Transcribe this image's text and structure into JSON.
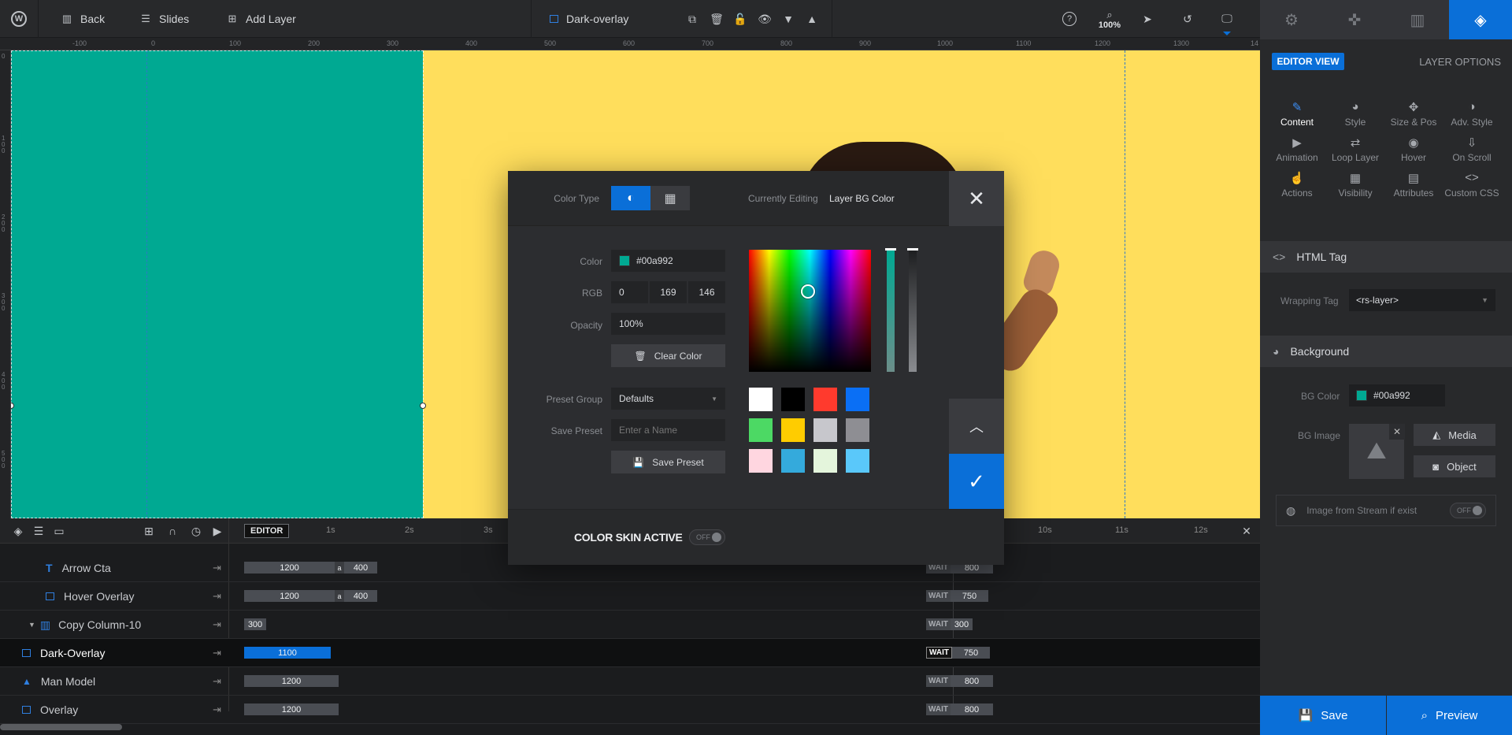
{
  "topbar": {
    "back": "Back",
    "slides": "Slides",
    "add_layer": "Add Layer",
    "layer_name": "Dark-overlay",
    "zoom": "100%"
  },
  "rpanel": {
    "tabs": [
      "settings",
      "navigation",
      "slides",
      "layers"
    ],
    "editor_view": "EDITOR VIEW",
    "layer_options": "LAYER OPTIONS",
    "options": [
      {
        "label": "Content",
        "icon": "✎"
      },
      {
        "label": "Style",
        "icon": "◕"
      },
      {
        "label": "Size & Pos",
        "icon": "✥"
      },
      {
        "label": "Adv. Style",
        "icon": "◑"
      },
      {
        "label": "Animation",
        "icon": "▶"
      },
      {
        "label": "Loop Layer",
        "icon": "⇄"
      },
      {
        "label": "Hover",
        "icon": "◉"
      },
      {
        "label": "On Scroll",
        "icon": "⇩"
      },
      {
        "label": "Actions",
        "icon": "☝"
      },
      {
        "label": "Visibility",
        "icon": "▦"
      },
      {
        "label": "Attributes",
        "icon": "▤"
      },
      {
        "label": "Custom CSS",
        "icon": "<>"
      }
    ],
    "html_tag": {
      "title": "HTML Tag",
      "wrapping_label": "Wrapping Tag",
      "wrapping_value": "<rs-layer>"
    },
    "background": {
      "title": "Background",
      "bg_color_label": "BG Color",
      "bg_color_value": "#00a992",
      "bg_image_label": "BG Image",
      "media": "Media",
      "object": "Object",
      "stream_label": "Image from Stream if exist",
      "stream_toggle": "OFF"
    },
    "save": "Save",
    "preview": "Preview"
  },
  "ruler": {
    "top": [
      "-100",
      "0",
      "100",
      "200",
      "300",
      "400",
      "500",
      "600",
      "700",
      "800",
      "900",
      "1000",
      "1100",
      "1200",
      "1300",
      "14"
    ],
    "left": [
      "0",
      "100",
      "200",
      "300",
      "400",
      "500"
    ]
  },
  "timeline": {
    "editor": "EDITOR",
    "ticks": [
      "1s",
      "2s",
      "3s",
      "10s",
      "11s",
      "12s"
    ],
    "layers": [
      {
        "name": "Arrow Cta",
        "start": "1200",
        "a": "a",
        "dur": "400",
        "wait": "WAIT",
        "end": "800"
      },
      {
        "name": "Hover Overlay",
        "start": "1200",
        "a": "a",
        "dur": "400",
        "wait": "WAIT",
        "end": "750"
      },
      {
        "name": "Copy Column-10",
        "start": "300",
        "wait": "WAIT",
        "end": "300"
      },
      {
        "name": "Dark-Overlay",
        "start": "1100",
        "wait": "WAIT",
        "end": "750"
      },
      {
        "name": "Man Model",
        "start": "1200",
        "wait": "WAIT",
        "end": "800"
      },
      {
        "name": "Overlay",
        "start": "1200",
        "wait": "WAIT",
        "end": "800"
      }
    ]
  },
  "modal": {
    "color_type_label": "Color Type",
    "currently_editing_label": "Currently Editing",
    "currently_editing_value": "Layer BG Color",
    "color_label": "Color",
    "color_hex": "#00a992",
    "rgb_label": "RGB",
    "r": "0",
    "g": "169",
    "b": "146",
    "opacity_label": "Opacity",
    "opacity_value": "100%",
    "clear_color": "Clear Color",
    "preset_group_label": "Preset Group",
    "preset_group_value": "Defaults",
    "save_preset_label": "Save Preset",
    "save_preset_placeholder": "Enter a Name",
    "save_preset_button": "Save Preset",
    "presets": [
      "#ffffff",
      "#000000",
      "#ff3a2d",
      "#0a6ff5",
      "#4cd964",
      "#ffcc00",
      "#c7c7cc",
      "#8e8e93",
      "#ffd6e0",
      "#34aadc",
      "#e4f5dc",
      "#5ac8fa"
    ],
    "skin_label": "COLOR SKIN ACTIVE",
    "skin_toggle": "OFF"
  }
}
